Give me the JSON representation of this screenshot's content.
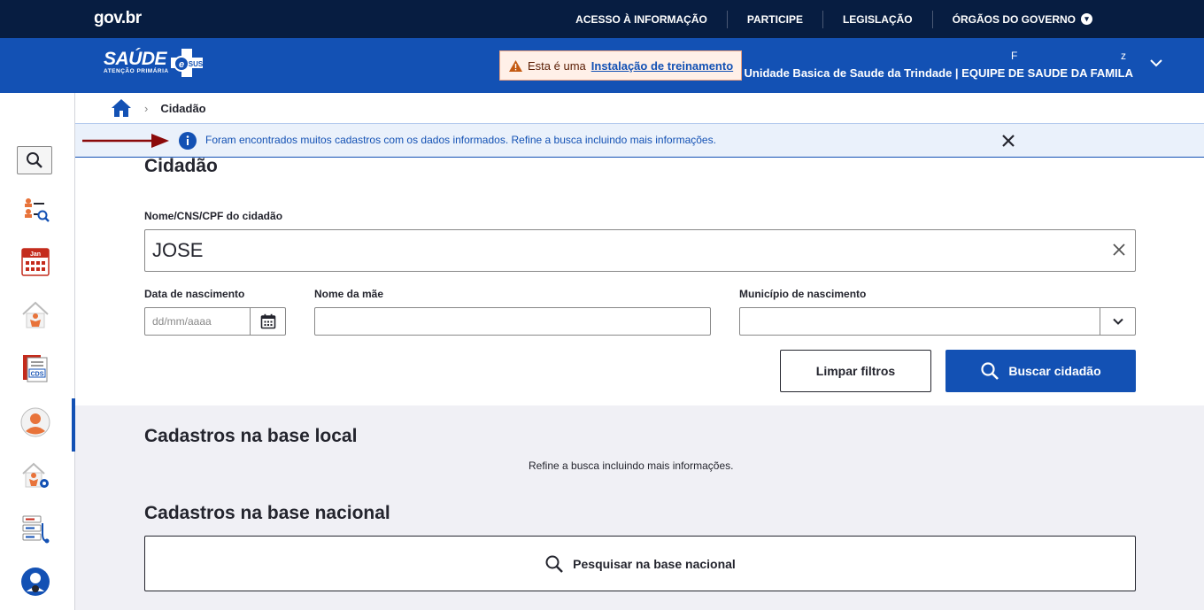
{
  "govbar": {
    "logo": "gov.br",
    "links": [
      "ACESSO À INFORMAÇÃO",
      "PARTICIPE",
      "LEGISLAÇÃO",
      "ÓRGÃOS DO GOVERNO"
    ]
  },
  "header": {
    "brand": "SAÚDE",
    "brand_badge": "SUS",
    "brand_sub": "ATENÇÃO PRIMÁRIA",
    "training_prefix": "Esta é uma",
    "training_link": "Instalação de treinamento",
    "user_first": "F",
    "user_last": "z",
    "unit": "Unidade Basica de Saude da Trindade | EQUIPE DE SAUDE DA FAMILA"
  },
  "breadcrumb": {
    "current": "Cidadão"
  },
  "alert": {
    "message": "Foram encontrados muitos cadastros com os dados informados. Refine a busca incluindo mais informações."
  },
  "sidebar": {
    "calendar_month": "Jan",
    "cds_label": "CDS"
  },
  "form": {
    "title": "Cidadão",
    "name_label": "Nome/CNS/CPF do cidadão",
    "name_value": "JOSE",
    "birth_label": "Data de nascimento",
    "birth_placeholder": "dd/mm/aaaa",
    "mother_label": "Nome da mãe",
    "city_label": "Município de nascimento",
    "clear_button": "Limpar filtros",
    "search_button": "Buscar cidadão"
  },
  "results": {
    "local_title": "Cadastros na base local",
    "local_message": "Refine a busca incluindo mais informações.",
    "national_title": "Cadastros na base nacional",
    "national_button": "Pesquisar na base nacional"
  },
  "colors": {
    "gov_navy": "#071d41",
    "primary_blue": "#1351b4",
    "alert_bg": "#eaf1fb",
    "warning_bg": "#fff0e8",
    "arrow_red": "#8b0a0a"
  }
}
